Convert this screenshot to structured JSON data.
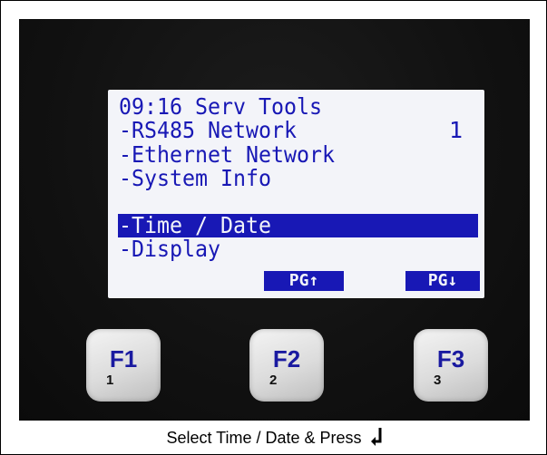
{
  "lcd": {
    "lines": [
      "09:16 Serv Tools",
      "-RS485 Network",
      "-Ethernet Network",
      "-System Info",
      "-Time / Date",
      "-Display"
    ],
    "rs485_value": "1",
    "selected_index": 4,
    "softkeys": [
      "PG↑",
      "PG↓"
    ]
  },
  "keys": [
    {
      "label": "F1",
      "number": "1"
    },
    {
      "label": "F2",
      "number": "2"
    },
    {
      "label": "F3",
      "number": "3"
    }
  ],
  "caption": {
    "text": "Select Time / Date  & Press",
    "icon": "enter-key-icon"
  },
  "colors": {
    "lcd_text": "#1818b5",
    "lcd_background": "#f3f4f9",
    "device_body": "#111111",
    "key_label": "#1a1aa0"
  }
}
